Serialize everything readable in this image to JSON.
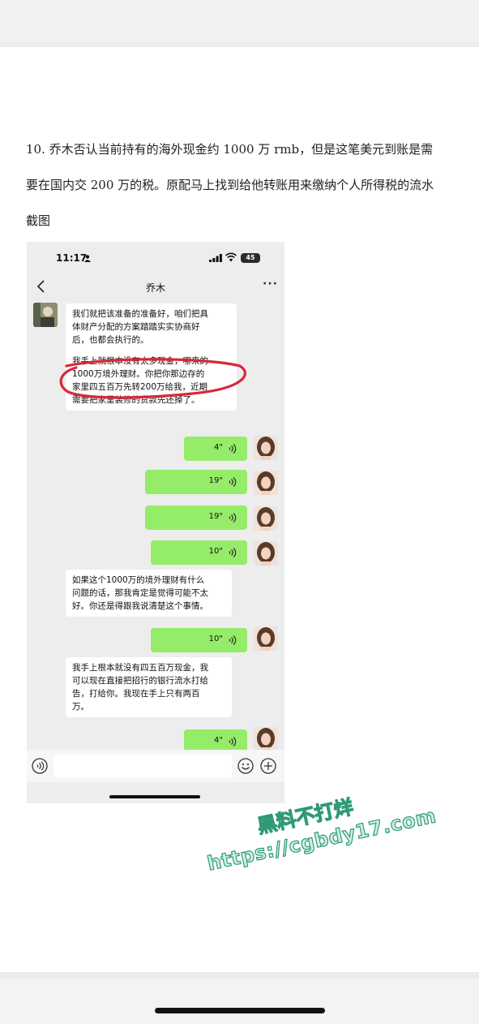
{
  "document": {
    "lines": [
      "10.  乔木否认当前持有的海外现金约 1000 万 rmb，但是这笔美元到账是需",
      "要在国内交 200 万的税。原配马上找到给他转账用来缴纳个人所得税的流水",
      "截图"
    ]
  },
  "phone": {
    "status": {
      "time": "11:17",
      "battery": "45"
    },
    "chat_title": "乔木",
    "more_label": "···",
    "messages": {
      "m1": [
        "我们就把该准备的准备好，咱们把具",
        "体财产分配的方案踏踏实实协商好",
        "后，也都会执行的。"
      ],
      "m2": [
        "我手上就根本没有太多现金，哪来的",
        "1000万境外理财。你把你那边存的",
        "家里四五百万先转200万给我，近期",
        "需要把家里装修的贷款先还掉了。"
      ],
      "v1": "4\"",
      "v2": "19\"",
      "v3": "19\"",
      "v4": "10\"",
      "m3": [
        "如果这个1000万的境外理财有什么",
        "问题的话，那我肯定是觉得可能不太",
        "好。你还是得跟我说清楚这个事情。"
      ],
      "v5": "10\"",
      "m4": [
        "我手上根本就没有四五百万现金，我",
        "可以现在直接把招行的银行流水打给",
        "告，打给你。我现在手上只有两百",
        "万。"
      ],
      "v6": "4\""
    }
  },
  "watermark": {
    "line1": "黑料不打烊",
    "line2": "https://cgbdy17.com"
  },
  "colors": {
    "voice_bubble": "#95ec69",
    "annotation": "#d8283a",
    "watermark_text": "#2f9a74"
  }
}
